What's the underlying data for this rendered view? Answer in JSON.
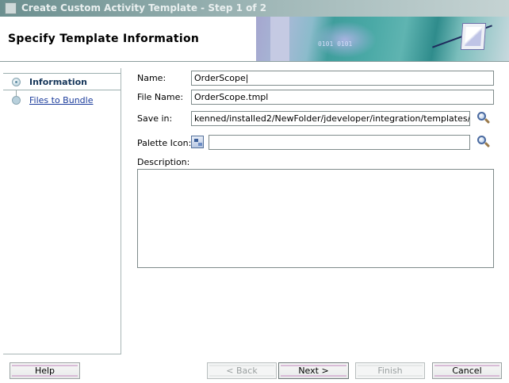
{
  "window": {
    "title": "Create Custom Activity Template - Step 1 of 2"
  },
  "header": {
    "title": "Specify Template Information",
    "banner_text": "0101 0101"
  },
  "nav": {
    "items": [
      {
        "label": "Information",
        "state": "current"
      },
      {
        "label": "Files to Bundle",
        "state": "link"
      }
    ]
  },
  "form": {
    "name": {
      "label": "Name:",
      "value": "OrderScope"
    },
    "file_name": {
      "label": "File Name:",
      "value": "OrderScope.tmpl"
    },
    "save_in": {
      "label": "Save in:",
      "value": "kenned/installed2/NewFolder/jdeveloper/integration/templates/"
    },
    "palette_icon": {
      "label": "Palette Icon:",
      "value": ""
    },
    "description": {
      "label": "Description:",
      "value": ""
    }
  },
  "buttons": {
    "help": "Help",
    "back": "< Back",
    "next": "Next >",
    "finish": "Finish",
    "cancel": "Cancel"
  },
  "colors": {
    "titlebar": "#6b8f8f",
    "nav_current_text": "#16365a",
    "link": "#1a3b9b",
    "button_accent": "#d9bcd7"
  }
}
